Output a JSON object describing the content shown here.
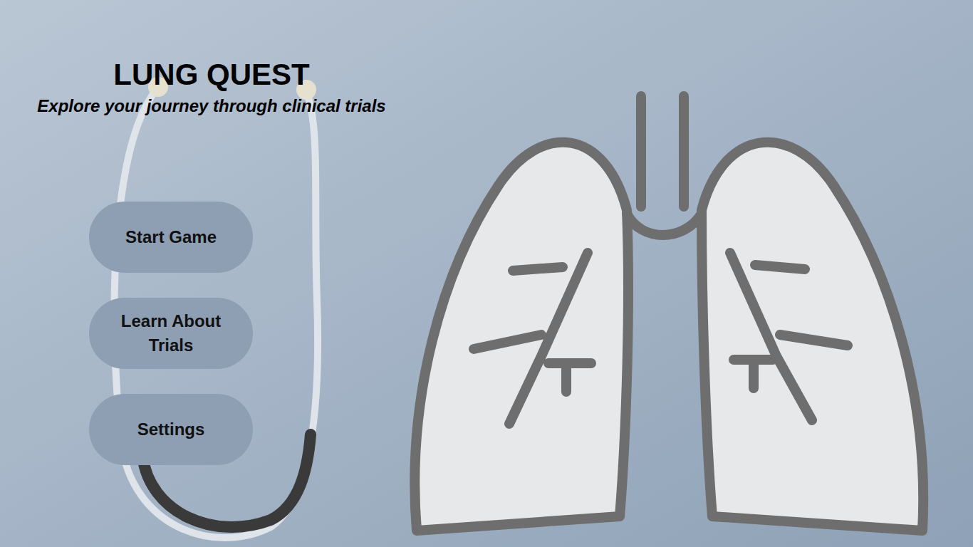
{
  "title": "LUNG QUEST",
  "subtitle": "Explore your journey through clinical trials",
  "menu": [
    {
      "label": "Start Game"
    },
    {
      "label": "Learn About Trials"
    },
    {
      "label": "Settings"
    }
  ]
}
